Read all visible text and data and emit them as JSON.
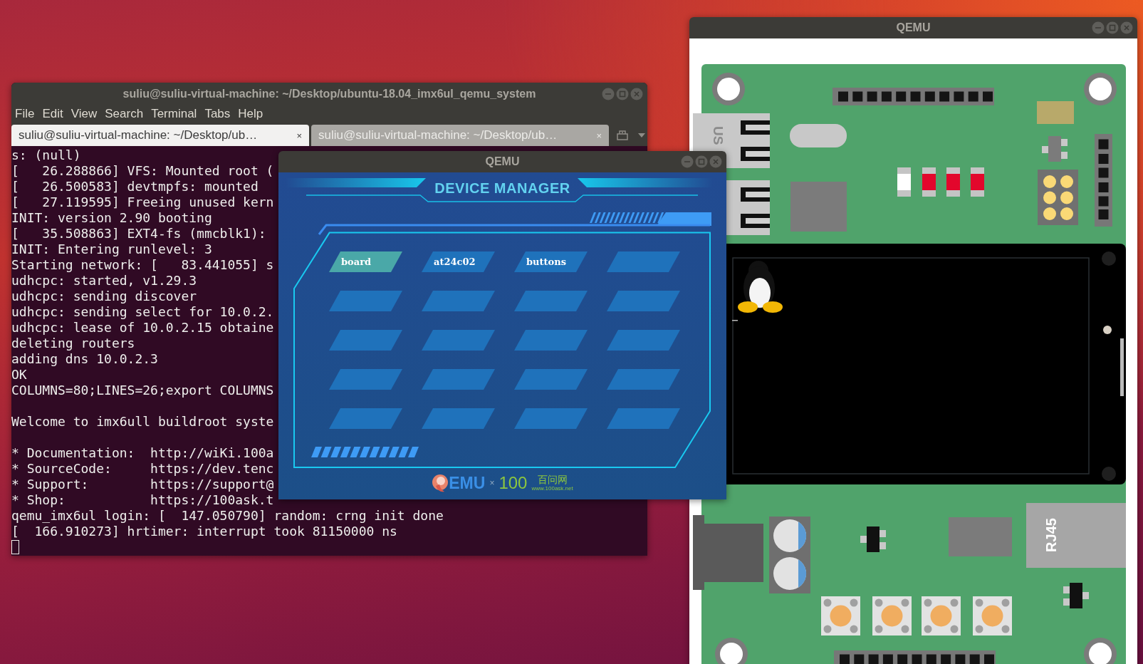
{
  "terminal": {
    "title": "suliu@suliu-virtual-machine: ~/Desktop/ubuntu-18.04_imx6ul_qemu_system",
    "menu": [
      "File",
      "Edit",
      "View",
      "Search",
      "Terminal",
      "Tabs",
      "Help"
    ],
    "tabs": [
      {
        "label": "suliu@suliu-virtual-machine: ~/Desktop/ub…",
        "close": "×",
        "selected": true
      },
      {
        "label": "suliu@suliu-virtual-machine: ~/Desktop/ub…",
        "close": "×",
        "selected": false
      }
    ],
    "output": [
      {
        "lines": [
          "s: (null)",
          "[   26.288866] VFS: Mounted root (",
          "[   26.500583] devtmpfs: mounted",
          "[   27.119595] Freeing unused kern",
          "INIT: version 2.90 booting",
          "[   35.508863] EXT4-fs (mmcblk1):",
          "INIT: Entering runlevel: 3",
          "Starting network: [   83.441055] s",
          "udhcpc: started, v1.29.3",
          "udhcpc: sending discover",
          "udhcpc: sending select for 10.0.2.",
          "udhcpc: lease of 10.0.2.15 obtaine",
          "deleting routers",
          "adding dns 10.0.2.3",
          "OK",
          "COLUMNS=80;LINES=26;export COLUMNS"
        ]
      },
      {
        "lines": [
          "Welcome to imx6ull buildroot syste"
        ]
      },
      {
        "lines": [
          "* Documentation:  http://wiKi.100a",
          "* SourceCode:     https://dev.tenc",
          "* Support:        https://support@",
          "* Shop:           https://100ask.t",
          "qemu_imx6ul login: [  147.050790] random: crng init done",
          "[  166.910273] hrtimer: interrupt took 81150000 ns"
        ]
      }
    ]
  },
  "device_manager": {
    "title": "QEMU",
    "heading": "DEVICE MANAGER",
    "devices": [
      {
        "label": "board",
        "selected": true
      },
      {
        "label": "at24c02",
        "selected": false
      },
      {
        "label": "buttons",
        "selected": false
      },
      {
        "selected": false
      },
      {
        "selected": false
      },
      {
        "selected": false
      },
      {
        "selected": false
      },
      {
        "selected": false
      },
      {
        "selected": false
      },
      {
        "selected": false
      },
      {
        "selected": false
      },
      {
        "selected": false
      },
      {
        "selected": false
      },
      {
        "selected": false
      },
      {
        "selected": false
      },
      {
        "selected": false
      },
      {
        "selected": false
      },
      {
        "selected": false
      },
      {
        "selected": false
      },
      {
        "selected": false
      }
    ],
    "footer": {
      "qemu_text": "EMU",
      "separator": "×",
      "brand_number": "100",
      "brand_name": "百问网",
      "brand_url": "www.100ask.net"
    }
  },
  "board_window": {
    "title": "QEMU",
    "usb_label": "US",
    "rj45_label": "RJ45"
  }
}
